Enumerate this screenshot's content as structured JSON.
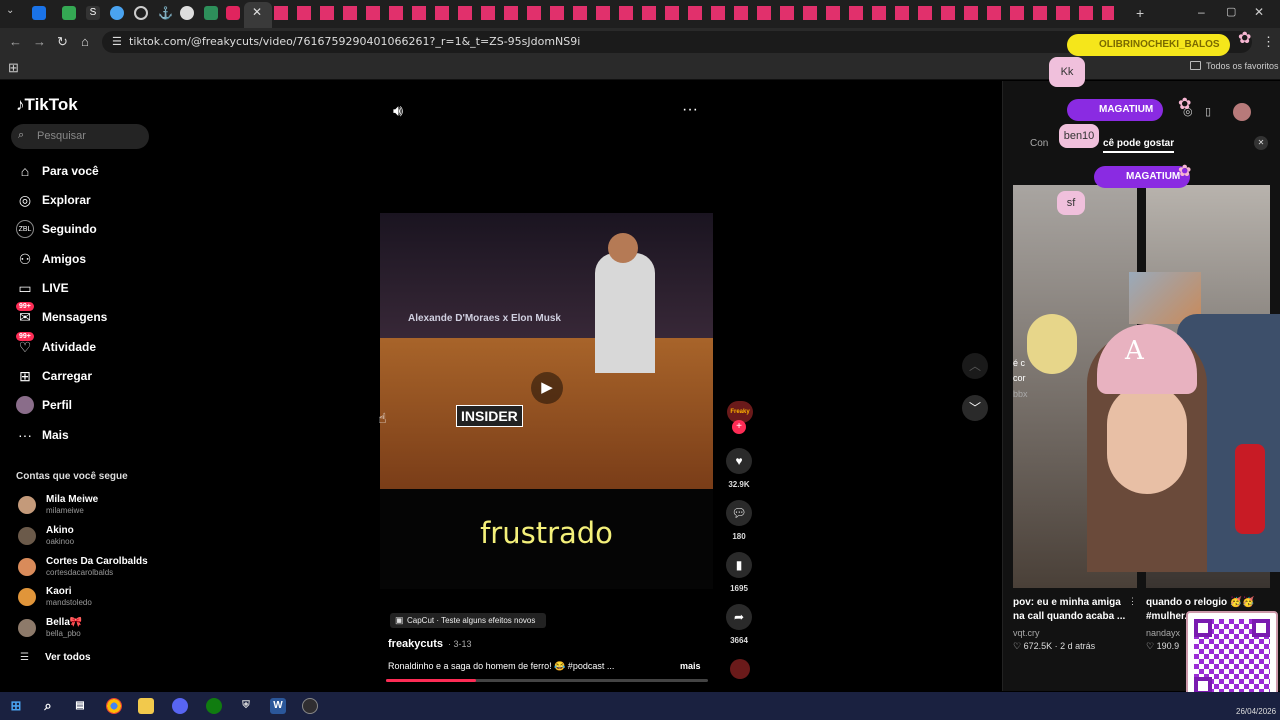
{
  "browser": {
    "url": "tiktok.com/@freakycuts/video/7616759290401066261?_r=1&_t=ZS-95sJdomNS9i",
    "bookmarks_all": "Todos os favoritos"
  },
  "tiktok": {
    "logo": "TikTok",
    "search_placeholder": "Pesquisar",
    "nav": [
      {
        "label": "Para você",
        "icon": "home-icon"
      },
      {
        "label": "Explorar",
        "icon": "compass-icon"
      },
      {
        "label": "Seguindo",
        "icon": "following-icon"
      },
      {
        "label": "Amigos",
        "icon": "friends-icon"
      },
      {
        "label": "LIVE",
        "icon": "live-icon"
      },
      {
        "label": "Mensagens",
        "icon": "messages-icon",
        "badge": "99+"
      },
      {
        "label": "Atividade",
        "icon": "activity-icon",
        "badge": "99+"
      },
      {
        "label": "Carregar",
        "icon": "upload-icon"
      },
      {
        "label": "Perfil",
        "icon": "profile-icon"
      },
      {
        "label": "Mais",
        "icon": "more-icon"
      }
    ],
    "following_title": "Contas que você segue",
    "accounts": [
      {
        "name": "Mila Meiwe",
        "handle": "milameiwe"
      },
      {
        "name": "Akino",
        "handle": "oakinoo"
      },
      {
        "name": "Cortes Da Carolbalds",
        "handle": "cortesdacarolbalds"
      },
      {
        "name": "Kaori",
        "handle": "mandstoledo"
      },
      {
        "name": "Bella🎀",
        "handle": "bella_pbo"
      }
    ],
    "see_all": "Ver todos"
  },
  "video": {
    "overlay_title": "Alexande D'Moraes x Elon Musk",
    "watermark": "INSIDER",
    "caption_word": "frustrado",
    "effect_label": "CapCut · Teste alguns efeitos novos",
    "author": "freakycuts",
    "date": "· 3-13",
    "description": "Ronaldinho e a saga do homem de ferro! 😂 #podcast ...",
    "more": "mais",
    "progress": 0.28,
    "likes": "32.9K",
    "comments": "180",
    "saves": "1695",
    "shares": "3664",
    "channel_logo": "Freaky"
  },
  "right_panel": {
    "tab_left": "Con",
    "tab_right": "cê pode gostar",
    "card1_title": "pov: eu e minha amiga na call quando acaba ...",
    "card1_author": "vqt.cry",
    "card1_meta": "♡ 672.5K · 2 d atrás",
    "card2_title": "quando o relogio 🥳🥳 #mulher...",
    "card2_author": "nandayx",
    "card2_meta": "♡ 190.9",
    "card_partial_1": "é c",
    "card_partial_2": "cor",
    "card_partial_3": "bbx"
  },
  "overlays": {
    "top_pill": "OLIBRINOCHEKI_BALOS",
    "pill1": "MAGATIUM",
    "pill2": "MAGATIUM",
    "chat1": "Kk",
    "chat2": "ben10",
    "chat3": "sf"
  },
  "taskbar": {
    "date": "26/04/2026"
  },
  "colors": {
    "accent": "#fe2c55",
    "caption_yellow": "#f4f07a",
    "pill_purple": "#8a2be2",
    "pill_yellow": "#f5e61b"
  }
}
